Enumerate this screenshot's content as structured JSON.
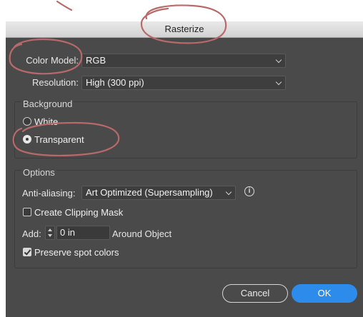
{
  "dialog": {
    "title": "Rasterize"
  },
  "color_model": {
    "label": "Color Model:",
    "value": "RGB"
  },
  "resolution": {
    "label": "Resolution:",
    "value": "High (300 ppi)"
  },
  "background": {
    "title": "Background",
    "options": [
      {
        "label": "White",
        "selected": false
      },
      {
        "label": "Transparent",
        "selected": true
      }
    ]
  },
  "options": {
    "title": "Options",
    "anti_aliasing": {
      "label": "Anti-aliasing:",
      "value": "Art Optimized (Supersampling)"
    },
    "info_icon": "i",
    "clipping_mask": {
      "label": "Create Clipping Mask",
      "checked": false
    },
    "add": {
      "label": "Add:",
      "value": "0 in",
      "suffix": "Around Object"
    },
    "spot_colors": {
      "label": "Preserve spot colors",
      "checked": true
    }
  },
  "buttons": {
    "cancel": "Cancel",
    "ok": "OK"
  },
  "colors": {
    "dialog_bg": "#4a4a4a",
    "accent": "#2d8ceb",
    "annotation": "#b86a6a"
  }
}
